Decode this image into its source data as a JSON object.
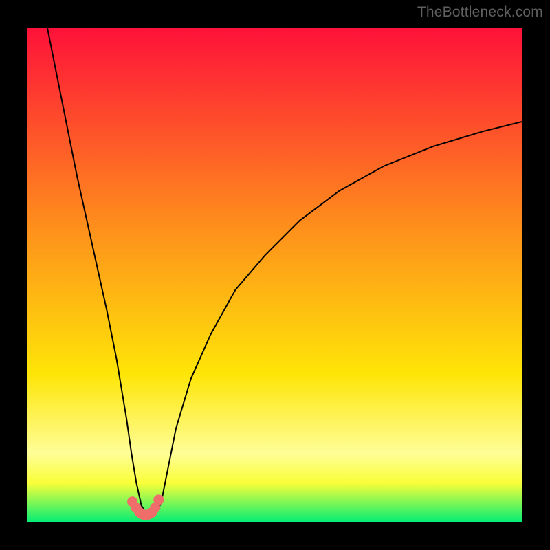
{
  "watermark": "TheBottleneck.com",
  "colors": {
    "frame": "#000000",
    "gradient_top": "#fe1139",
    "gradient_mid_upper": "#fe8e1c",
    "gradient_mid": "#fee507",
    "gradient_mid_lower": "#fefe97",
    "gradient_lower": "#fafe38",
    "gradient_bottom": "#00ee74",
    "curve": "#000000",
    "marker_fill": "#ef6d6a",
    "marker_stroke": "#ef6d6a"
  },
  "chart_data": {
    "type": "line",
    "title": "",
    "xlabel": "",
    "ylabel": "",
    "xlim": [
      0,
      100
    ],
    "ylim": [
      0,
      100
    ],
    "series": [
      {
        "name": "bottleneck-curve",
        "x": [
          4,
          6,
          8,
          10,
          12,
          14,
          16,
          18,
          19,
          20,
          21,
          22,
          23,
          24,
          25,
          26,
          27,
          28,
          30,
          33,
          37,
          42,
          48,
          55,
          63,
          72,
          82,
          92,
          100
        ],
        "y": [
          100,
          90,
          80,
          70,
          61,
          52,
          43,
          33,
          27,
          21,
          14,
          8,
          3.5,
          1.6,
          1.3,
          1.8,
          4,
          9,
          19,
          29,
          38,
          47,
          54,
          61,
          67,
          72,
          76,
          79,
          81
        ]
      }
    ],
    "markers": {
      "name": "highlight-points",
      "x": [
        21.2,
        21.9,
        22.6,
        23.1,
        23.7,
        24.4,
        25.1,
        25.8,
        26.5
      ],
      "y": [
        4.2,
        3.0,
        2.1,
        1.7,
        1.5,
        1.6,
        2.0,
        3.0,
        4.6
      ]
    }
  }
}
